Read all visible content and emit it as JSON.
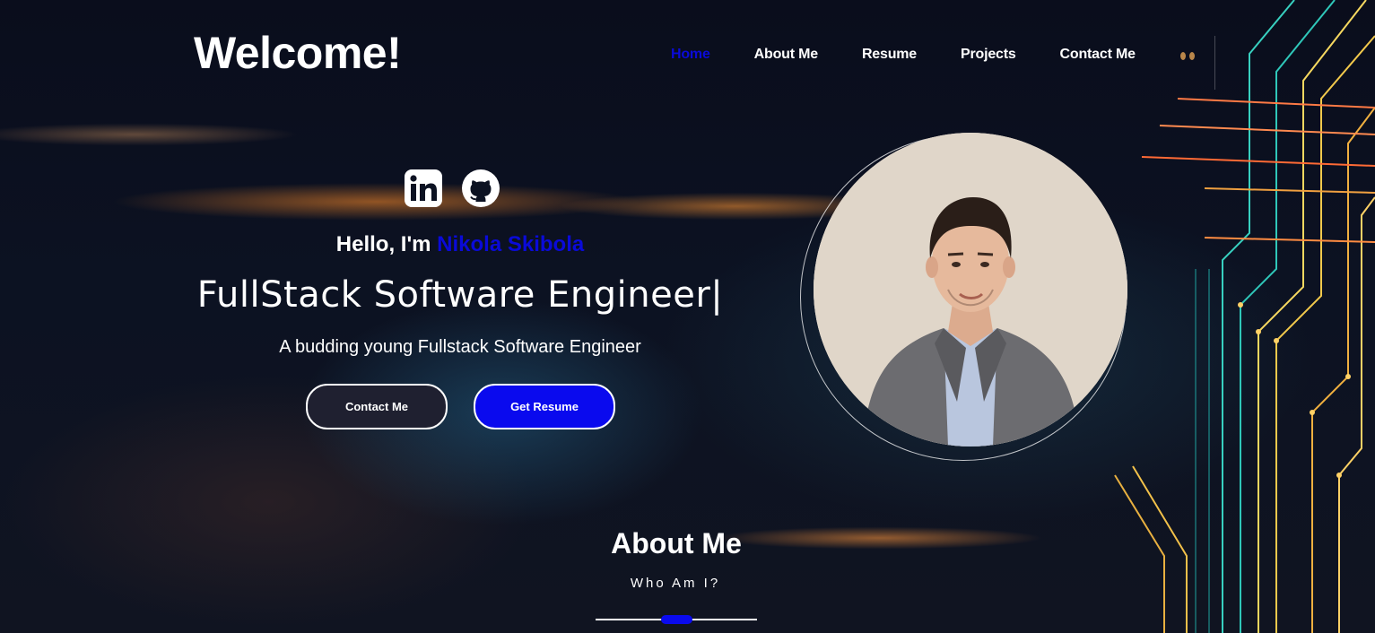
{
  "header": {
    "title": "Welcome!"
  },
  "nav": {
    "items": [
      {
        "label": "Home",
        "active": true
      },
      {
        "label": "About Me"
      },
      {
        "label": "Resume"
      },
      {
        "label": "Projects"
      },
      {
        "label": "Contact Me"
      }
    ]
  },
  "hero": {
    "socials": [
      "linkedin-icon",
      "github-icon"
    ],
    "greeting": "Hello, I'm ",
    "name": "Nikola Skibola",
    "role": "FullStack Software Engineer|",
    "tagline": "A budding young Fullstack Software Engineer",
    "contact_button": "Contact Me",
    "resume_button": "Get Resume"
  },
  "about": {
    "title": "About Me",
    "subtitle": "Who Am I?"
  },
  "colors": {
    "accent": "#0a0aee",
    "active_link": "#0a0ad8",
    "background": "#0c1222"
  }
}
